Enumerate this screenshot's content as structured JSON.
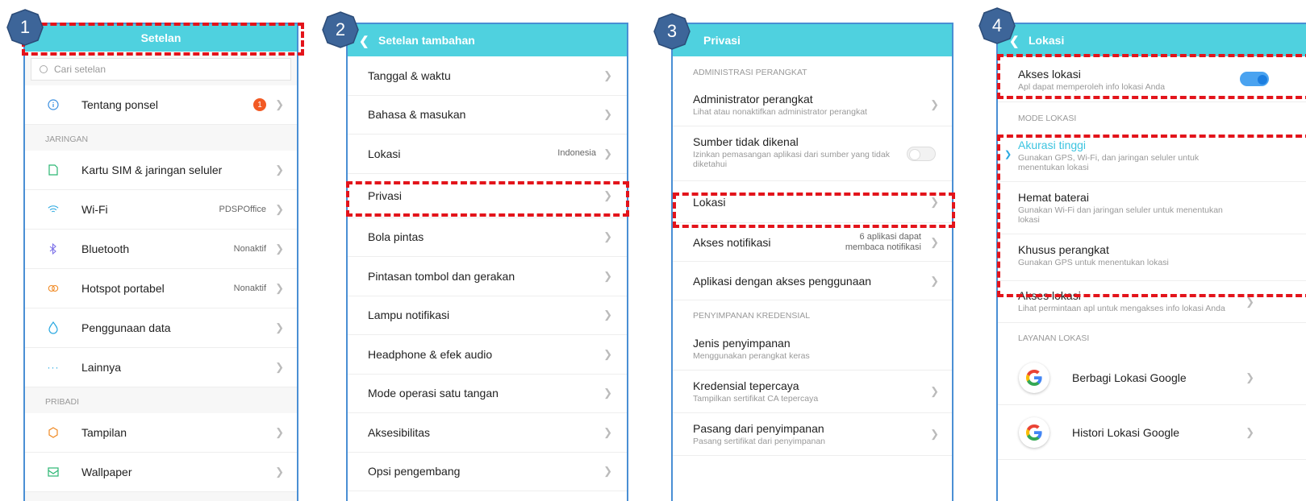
{
  "steps": [
    "1",
    "2",
    "3",
    "4"
  ],
  "colors": {
    "accent": "#4fd1df",
    "highlight": "#e3141b",
    "step_badge": "#3d6599",
    "frame": "#4a8fd4",
    "badge_orange": "#f25a24"
  },
  "panel1": {
    "title": "Setelan",
    "search_placeholder": "Cari setelan",
    "top": {
      "label": "Tentang ponsel",
      "badge": "1",
      "icon": "info-icon"
    },
    "section_network": "JARINGAN",
    "network": [
      {
        "label": "Kartu SIM & jaringan seluler",
        "value": "",
        "icon": "sim-card-icon"
      },
      {
        "label": "Wi-Fi",
        "value": "PDSPOffice",
        "icon": "wifi-icon"
      },
      {
        "label": "Bluetooth",
        "value": "Nonaktif",
        "icon": "bluetooth-icon"
      },
      {
        "label": "Hotspot portabel",
        "value": "Nonaktif",
        "icon": "hotspot-icon"
      },
      {
        "label": "Penggunaan data",
        "value": "",
        "icon": "data-usage-icon"
      },
      {
        "label": "Lainnya",
        "value": "",
        "icon": "more-icon"
      }
    ],
    "section_personal": "PRIBADI",
    "personal": [
      {
        "label": "Tampilan",
        "icon": "display-icon"
      },
      {
        "label": "Wallpaper",
        "icon": "wallpaper-icon"
      }
    ]
  },
  "panel2": {
    "title": "Setelan tambahan",
    "items": [
      {
        "label": "Tanggal & waktu",
        "value": ""
      },
      {
        "label": "Bahasa & masukan",
        "value": ""
      },
      {
        "label": "Lokasi",
        "value": "Indonesia"
      },
      {
        "label": "Privasi",
        "value": ""
      },
      {
        "label": "Bola pintas",
        "value": ""
      },
      {
        "label": "Pintasan tombol dan gerakan",
        "value": ""
      },
      {
        "label": "Lampu notifikasi",
        "value": ""
      },
      {
        "label": "Headphone & efek audio",
        "value": ""
      },
      {
        "label": "Mode operasi satu tangan",
        "value": ""
      },
      {
        "label": "Aksesibilitas",
        "value": ""
      },
      {
        "label": "Opsi pengembang",
        "value": ""
      }
    ]
  },
  "panel3": {
    "title": "Privasi",
    "section_admin": "ADMINISTRASI PERANGKAT",
    "admin_title": "Administrator perangkat",
    "admin_sub": "Lihat atau nonaktifkan administrator perangkat",
    "unknown_title": "Sumber tidak dikenal",
    "unknown_sub": "Izinkan pemasangan aplikasi dari sumber yang tidak diketahui",
    "location": "Lokasi",
    "notif_title": "Akses notifikasi",
    "notif_value_1": "6 aplikasi dapat",
    "notif_value_2": "membaca notifikasi",
    "usage": "Aplikasi dengan akses penggunaan",
    "section_cred": "PENYIMPANAN KREDENSIAL",
    "storage_title": "Jenis penyimpanan",
    "storage_sub": "Menggunakan perangkat keras",
    "trusted_title": "Kredensial tepercaya",
    "trusted_sub": "Tampilkan sertifikat CA tepercaya",
    "install_title": "Pasang dari penyimpanan",
    "install_sub": "Pasang sertifikat dari penyimpanan"
  },
  "panel4": {
    "title": "Lokasi",
    "access_title": "Akses lokasi",
    "access_sub": "Apl dapat memperoleh info lokasi Anda",
    "access_on": true,
    "section_mode": "MODE LOKASI",
    "modes": [
      {
        "title": "Akurasi tinggi",
        "sub": "Gunakan GPS, Wi-Fi, dan jaringan seluler untuk menentukan lokasi",
        "selected": true
      },
      {
        "title": "Hemat baterai",
        "sub": "Gunakan Wi-Fi dan jaringan seluler untuk menentukan lokasi",
        "selected": false
      },
      {
        "title": "Khusus perangkat",
        "sub": "Gunakan GPS untuk menentukan lokasi",
        "selected": false
      }
    ],
    "request_title": "Akses lokasi",
    "request_sub": "Lihat permintaan apl untuk mengakses info lokasi Anda",
    "section_services": "LAYANAN LOKASI",
    "services": [
      {
        "label": "Berbagi Lokasi Google",
        "icon": "google-icon"
      },
      {
        "label": "Histori Lokasi Google",
        "icon": "google-icon"
      }
    ]
  }
}
